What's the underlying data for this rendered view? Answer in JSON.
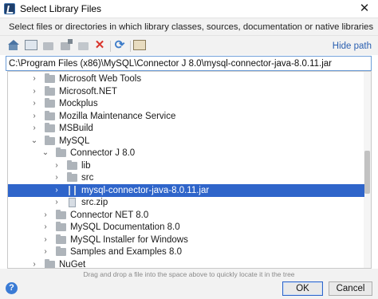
{
  "window": {
    "title": "Select Library Files",
    "close_glyph": "✕"
  },
  "description": "Select files or directories in which library classes, sources, documentation or native libraries are located",
  "toolbar": {
    "icons": [
      "home-icon",
      "desktop-icon",
      "project-folder-icon",
      "module-folder-icon",
      "new-folder-icon",
      "delete-icon",
      "refresh-icon",
      "show-path-icon"
    ],
    "delete_glyph": "✕",
    "refresh_glyph": "⟳",
    "hide_path_label": "Hide path"
  },
  "path": {
    "value": "C:\\Program Files (x86)\\MySQL\\Connector J 8.0\\mysql-connector-java-8.0.11.jar"
  },
  "tree": {
    "arrows": {
      "collapsed": "›",
      "expanded": "⌄"
    },
    "items": [
      {
        "label": "Microsoft Web Tools",
        "level": 0,
        "expanded": false,
        "icon": "folder-icon",
        "selected": false
      },
      {
        "label": "Microsoft.NET",
        "level": 0,
        "expanded": false,
        "icon": "folder-icon",
        "selected": false
      },
      {
        "label": "Mockplus",
        "level": 0,
        "expanded": false,
        "icon": "folder-icon",
        "selected": false
      },
      {
        "label": "Mozilla Maintenance Service",
        "level": 0,
        "expanded": false,
        "icon": "folder-icon",
        "selected": false
      },
      {
        "label": "MSBuild",
        "level": 0,
        "expanded": false,
        "icon": "folder-icon",
        "selected": false
      },
      {
        "label": "MySQL",
        "level": 0,
        "expanded": true,
        "icon": "folder-icon",
        "selected": false
      },
      {
        "label": "Connector J 8.0",
        "level": 1,
        "expanded": true,
        "icon": "folder-icon",
        "selected": false
      },
      {
        "label": "lib",
        "level": 2,
        "expanded": false,
        "icon": "folder-icon",
        "selected": false
      },
      {
        "label": "src",
        "level": 2,
        "expanded": false,
        "icon": "folder-icon",
        "selected": false
      },
      {
        "label": "mysql-connector-java-8.0.11.jar",
        "level": 2,
        "expanded": false,
        "icon": "jar-icon",
        "selected": true
      },
      {
        "label": "src.zip",
        "level": 2,
        "expanded": false,
        "icon": "zip-icon",
        "selected": false
      },
      {
        "label": "Connector NET 8.0",
        "level": 1,
        "expanded": false,
        "icon": "folder-icon",
        "selected": false
      },
      {
        "label": "MySQL Documentation 8.0",
        "level": 1,
        "expanded": false,
        "icon": "folder-icon",
        "selected": false
      },
      {
        "label": "MySQL Installer for Windows",
        "level": 1,
        "expanded": false,
        "icon": "folder-icon",
        "selected": false
      },
      {
        "label": "Samples and Examples 8.0",
        "level": 1,
        "expanded": false,
        "icon": "folder-icon",
        "selected": false
      },
      {
        "label": "NuGet",
        "level": 0,
        "expanded": false,
        "icon": "folder-icon",
        "selected": false
      }
    ]
  },
  "footer": {
    "hint": "Drag and drop a file into the space above to quickly locate it in the tree",
    "help_glyph": "?",
    "ok_label": "OK",
    "cancel_label": "Cancel"
  },
  "colors": {
    "selection": "#2f65ca",
    "link": "#2a5fb0",
    "help": "#3a7bd5"
  }
}
